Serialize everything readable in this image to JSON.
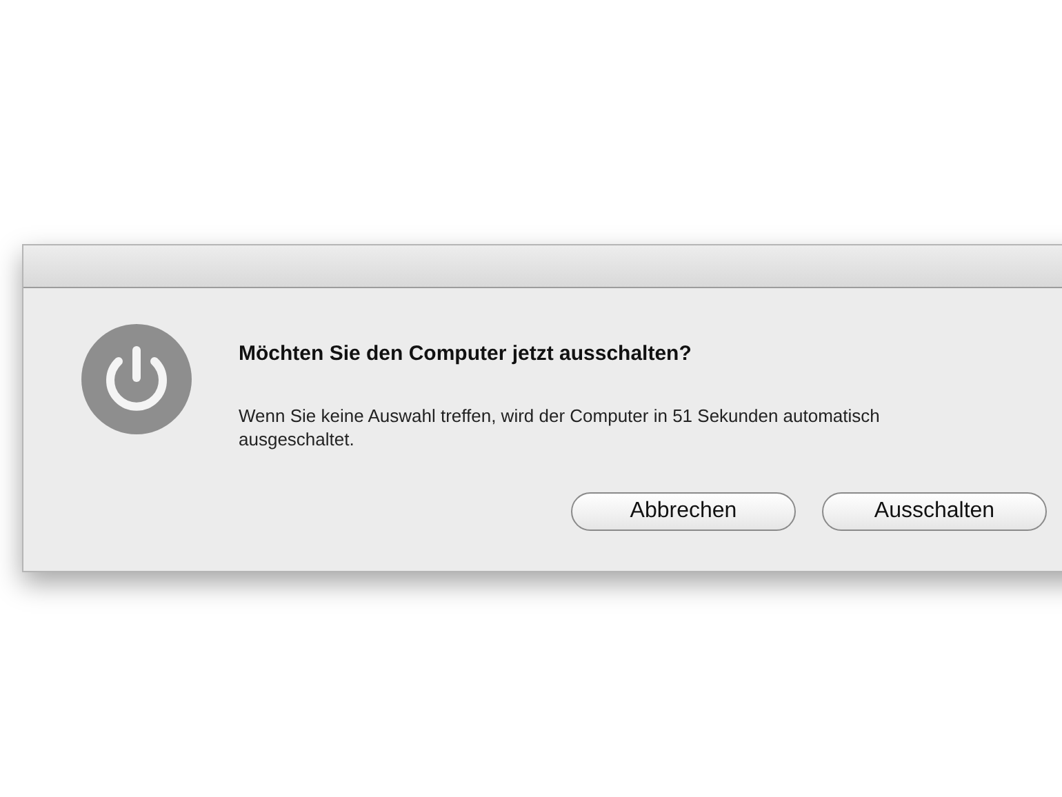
{
  "dialog": {
    "heading": "Möchten Sie den Computer jetzt ausschalten?",
    "message": "Wenn Sie keine Auswahl treffen, wird der Computer in 51 Sekunden automatisch ausgeschaltet.",
    "buttons": [
      {
        "label": "Abbrechen"
      },
      {
        "label": "Ausschalten"
      }
    ]
  }
}
